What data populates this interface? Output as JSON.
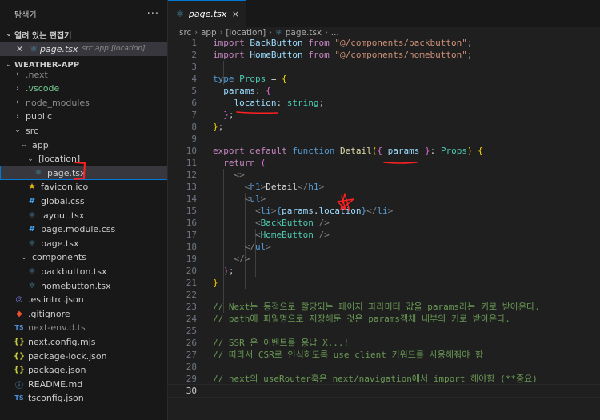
{
  "explorer": {
    "title": "탐색기",
    "more": "···",
    "open_editors": {
      "label": "열려 있는 편집기",
      "items": [
        {
          "name": "page.tsx",
          "path": "src\\app\\[location]"
        }
      ]
    },
    "project": {
      "label": "WEATHER-APP",
      "items": [
        {
          "label": ".next",
          "kind": "folder",
          "state": "collapsed",
          "style": "muted",
          "depth": 0
        },
        {
          "label": ".vscode",
          "kind": "folder",
          "state": "collapsed",
          "style": "green",
          "depth": 0
        },
        {
          "label": "node_modules",
          "kind": "folder",
          "state": "collapsed",
          "style": "muted",
          "depth": 0
        },
        {
          "label": "public",
          "kind": "folder",
          "state": "collapsed",
          "style": "normal",
          "depth": 0
        },
        {
          "label": "src",
          "kind": "folder",
          "state": "expanded",
          "style": "normal",
          "depth": 0
        },
        {
          "label": "app",
          "kind": "folder",
          "state": "expanded",
          "style": "normal",
          "depth": 1
        },
        {
          "label": "[location]",
          "kind": "folder",
          "state": "expanded",
          "style": "normal",
          "depth": 2
        },
        {
          "label": "page.tsx",
          "kind": "react",
          "style": "normal",
          "depth": 3,
          "selected": true
        },
        {
          "label": "favicon.ico",
          "kind": "star",
          "style": "normal",
          "depth": 2
        },
        {
          "label": "global.css",
          "kind": "css",
          "style": "normal",
          "depth": 2
        },
        {
          "label": "layout.tsx",
          "kind": "react",
          "style": "normal",
          "depth": 2
        },
        {
          "label": "page.module.css",
          "kind": "css",
          "style": "normal",
          "depth": 2
        },
        {
          "label": "page.tsx",
          "kind": "react",
          "style": "normal",
          "depth": 2
        },
        {
          "label": "components",
          "kind": "folder",
          "state": "expanded",
          "style": "normal",
          "depth": 1
        },
        {
          "label": "backbutton.tsx",
          "kind": "react",
          "style": "normal",
          "depth": 2
        },
        {
          "label": "homebutton.tsx",
          "kind": "react",
          "style": "normal",
          "depth": 2
        },
        {
          "label": ".eslintrc.json",
          "kind": "eslint",
          "style": "normal",
          "depth": 0
        },
        {
          "label": ".gitignore",
          "kind": "git",
          "style": "normal",
          "depth": 0
        },
        {
          "label": "next-env.d.ts",
          "kind": "ts",
          "style": "muted",
          "depth": 0
        },
        {
          "label": "next.config.mjs",
          "kind": "json",
          "style": "normal",
          "depth": 0
        },
        {
          "label": "package-lock.json",
          "kind": "json",
          "style": "normal",
          "depth": 0
        },
        {
          "label": "package.json",
          "kind": "json",
          "style": "normal",
          "depth": 0
        },
        {
          "label": "README.md",
          "kind": "info",
          "style": "normal",
          "depth": 0
        },
        {
          "label": "tsconfig.json",
          "kind": "ts",
          "style": "normal",
          "depth": 0
        }
      ]
    }
  },
  "editor": {
    "tab": {
      "name": "page.tsx",
      "close": "×"
    },
    "breadcrumb": [
      "src",
      "app",
      "[location]",
      "page.tsx",
      "..."
    ],
    "current_line": 30,
    "lines": [
      {
        "n": "1",
        "t": [
          [
            "kw",
            "import "
          ],
          [
            "vr",
            "BackButton"
          ],
          [
            "kw",
            " from "
          ],
          [
            "str",
            "\"@/components/backbutton\""
          ],
          [
            "pl",
            ";"
          ]
        ]
      },
      {
        "n": "2",
        "t": [
          [
            "kw",
            "import "
          ],
          [
            "vr",
            "HomeButton"
          ],
          [
            "kw",
            " from "
          ],
          [
            "str",
            "\"@/components/homebutton\""
          ],
          [
            "pl",
            ";"
          ]
        ]
      },
      {
        "n": "3",
        "t": []
      },
      {
        "n": "4",
        "t": [
          [
            "kb",
            "type "
          ],
          [
            "ty",
            "Props"
          ],
          [
            "pl",
            " = "
          ],
          [
            "br1",
            "{"
          ]
        ]
      },
      {
        "n": "5",
        "t": [
          [
            "pl",
            "  "
          ],
          [
            "vr",
            "params"
          ],
          [
            "pl",
            ": "
          ],
          [
            "br2",
            "{"
          ]
        ]
      },
      {
        "n": "6",
        "t": [
          [
            "pl",
            "    "
          ],
          [
            "vr",
            "location"
          ],
          [
            "pl",
            ": "
          ],
          [
            "ty",
            "string"
          ],
          [
            "pl",
            ";"
          ]
        ]
      },
      {
        "n": "7",
        "t": [
          [
            "pl",
            "  "
          ],
          [
            "br2",
            "}"
          ],
          [
            "pl",
            ";"
          ]
        ]
      },
      {
        "n": "8",
        "t": [
          [
            "br1",
            "}"
          ],
          [
            "pl",
            ";"
          ]
        ]
      },
      {
        "n": "9",
        "t": []
      },
      {
        "n": "10",
        "t": [
          [
            "kw",
            "export default "
          ],
          [
            "kb",
            "function "
          ],
          [
            "fn",
            "Detail"
          ],
          [
            "br1",
            "("
          ],
          [
            "br2",
            "{ "
          ],
          [
            "vr",
            "params"
          ],
          [
            "br2",
            " }"
          ],
          [
            "pl",
            ": "
          ],
          [
            "ty",
            "Props"
          ],
          [
            "br1",
            ")"
          ],
          [
            "pl",
            " "
          ],
          [
            "br1",
            "{"
          ]
        ]
      },
      {
        "n": "11",
        "t": [
          [
            "pl",
            "  "
          ],
          [
            "kw",
            "return "
          ],
          [
            "br2",
            "("
          ]
        ]
      },
      {
        "n": "12",
        "t": [
          [
            "pl",
            "    "
          ],
          [
            "tgp",
            "<>"
          ]
        ]
      },
      {
        "n": "13",
        "t": [
          [
            "pl",
            "      "
          ],
          [
            "tgp",
            "<"
          ],
          [
            "tg",
            "h1"
          ],
          [
            "tgp",
            ">"
          ],
          [
            "pl",
            "Detail"
          ],
          [
            "tgp",
            "</"
          ],
          [
            "tg",
            "h1"
          ],
          [
            "tgp",
            ">"
          ]
        ]
      },
      {
        "n": "14",
        "t": [
          [
            "pl",
            "      "
          ],
          [
            "tgp",
            "<"
          ],
          [
            "tg",
            "ul"
          ],
          [
            "tgp",
            ">"
          ]
        ]
      },
      {
        "n": "15",
        "t": [
          [
            "pl",
            "        "
          ],
          [
            "tgp",
            "<"
          ],
          [
            "tg",
            "li"
          ],
          [
            "tgp",
            ">"
          ],
          [
            "kb",
            "{"
          ],
          [
            "vr",
            "params"
          ],
          [
            "pl",
            "."
          ],
          [
            "vr",
            "location"
          ],
          [
            "kb",
            "}"
          ],
          [
            "tgp",
            "</"
          ],
          [
            "tg",
            "li"
          ],
          [
            "tgp",
            ">"
          ]
        ]
      },
      {
        "n": "16",
        "t": [
          [
            "pl",
            "        "
          ],
          [
            "tgp",
            "<"
          ],
          [
            "cmp",
            "BackButton"
          ],
          [
            "tgp",
            " />"
          ]
        ]
      },
      {
        "n": "17",
        "t": [
          [
            "pl",
            "        "
          ],
          [
            "tgp",
            "<"
          ],
          [
            "cmp",
            "HomeButton"
          ],
          [
            "tgp",
            " />"
          ]
        ]
      },
      {
        "n": "18",
        "t": [
          [
            "pl",
            "      "
          ],
          [
            "tgp",
            "</"
          ],
          [
            "tg",
            "ul"
          ],
          [
            "tgp",
            ">"
          ]
        ]
      },
      {
        "n": "19",
        "t": [
          [
            "pl",
            "    "
          ],
          [
            "tgp",
            "</>"
          ]
        ]
      },
      {
        "n": "20",
        "t": [
          [
            "pl",
            "  "
          ],
          [
            "br2",
            ")"
          ],
          [
            "pl",
            ";"
          ]
        ]
      },
      {
        "n": "21",
        "t": [
          [
            "br1",
            "}"
          ]
        ]
      },
      {
        "n": "22",
        "t": []
      },
      {
        "n": "23",
        "t": [
          [
            "cm",
            "// Next는 동적으로 할당되는 페이지 파라미터 값을 params라는 키로 받아온다."
          ]
        ]
      },
      {
        "n": "24",
        "t": [
          [
            "cm",
            "// path에 파일명으로 저장해둔 것은 params객체 내부의 키로 받아온다."
          ]
        ]
      },
      {
        "n": "25",
        "t": []
      },
      {
        "n": "26",
        "t": [
          [
            "cm",
            "// SSR 은 이벤트를 용납 X...!"
          ]
        ]
      },
      {
        "n": "27",
        "t": [
          [
            "cm",
            "// 따라서 CSR로 인식하도록 use client 키워드를 사용해줘야 함"
          ]
        ]
      },
      {
        "n": "28",
        "t": []
      },
      {
        "n": "29",
        "t": [
          [
            "cm",
            "// next의 useRouter훅은 next/navigation에서 import 해야함 (**중요)"
          ]
        ]
      },
      {
        "n": "30",
        "t": []
      }
    ]
  },
  "colors": {
    "accent": "#0078d4",
    "annotation": "#ff2020"
  }
}
